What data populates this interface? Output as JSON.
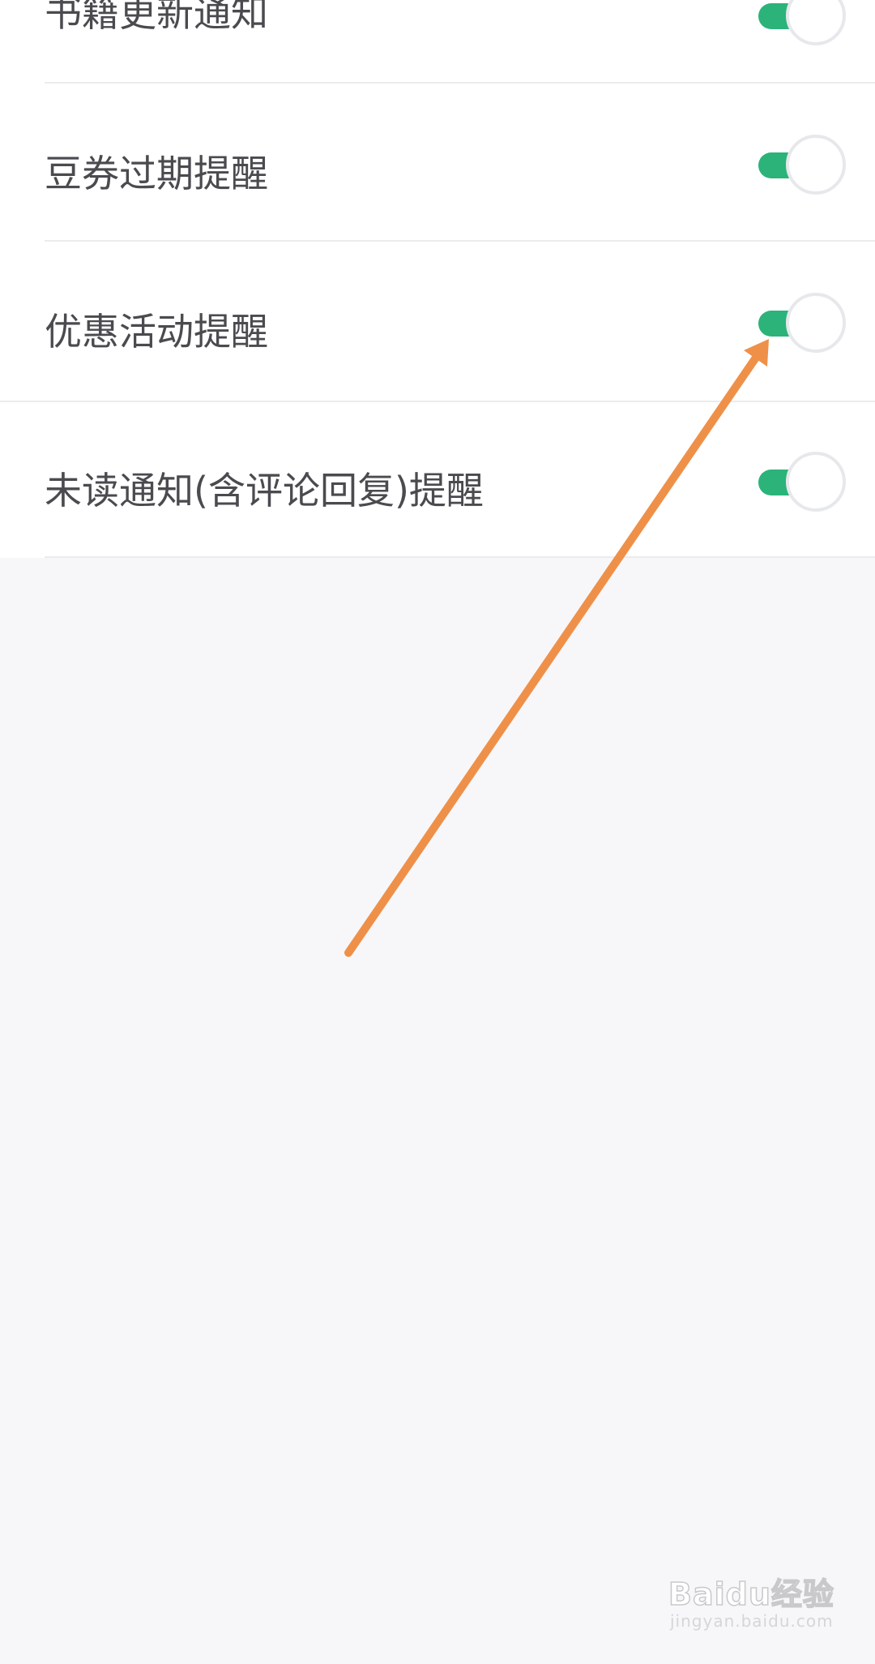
{
  "settings": {
    "items": [
      {
        "label": "书籍更新通知",
        "enabled": true
      },
      {
        "label": "豆券过期提醒",
        "enabled": true
      },
      {
        "label": "优惠活动提醒",
        "enabled": true
      },
      {
        "label": "未读通知(含评论回复)提醒",
        "enabled": true
      }
    ]
  },
  "colors": {
    "toggle_on": "#2bb37a",
    "annotation_arrow": "#ef9049",
    "background": "#f7f7f9"
  },
  "watermark": {
    "brand": "Baidu经验",
    "url": "jingyan.baidu.com"
  }
}
